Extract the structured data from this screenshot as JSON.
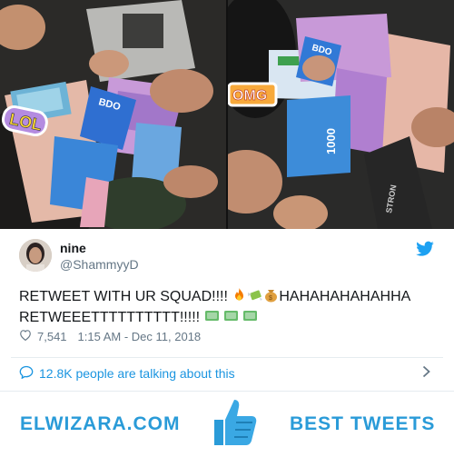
{
  "photos": {
    "left_sticker": "LOL",
    "right_sticker": "OMG",
    "card_brand": "BDO",
    "bill_value": "1000",
    "wallet_brand": "STRON"
  },
  "tweet": {
    "display_name": "nine",
    "handle": "@ShammyyD",
    "text_line1": "RETWEET WITH UR SQUAD!!!! ",
    "text_line1_end": "HAHAHAHAHAHHA",
    "text_line2": "RETWEEETTTTTTTTTT!!!!! ",
    "likes": "7,541",
    "timestamp": "1:15 AM - Dec 11, 2018",
    "talking": "12.8K people are talking about this"
  },
  "footer": {
    "site": "ELWIZARA.COM",
    "tagline": "BEST TWEETS"
  },
  "colors": {
    "accent": "#1b95e0",
    "footer_blue": "#2a9bd8"
  }
}
